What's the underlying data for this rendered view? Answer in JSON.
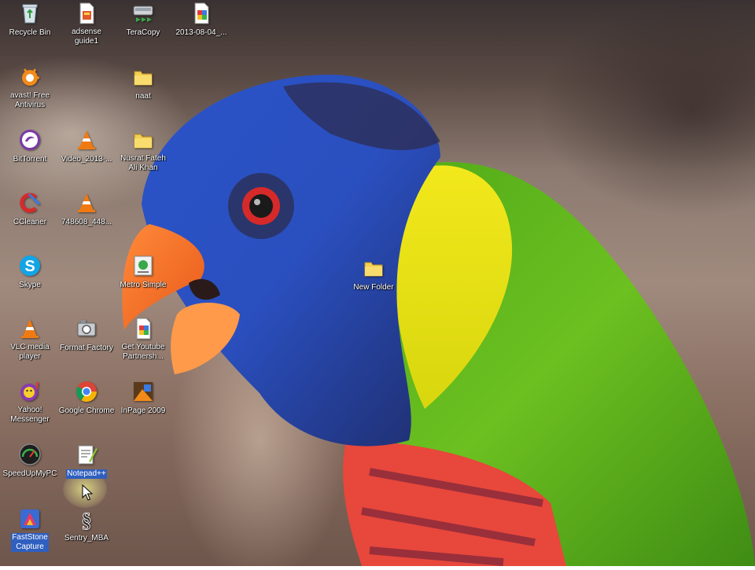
{
  "desktop": {
    "icons": [
      {
        "id": "recycle-bin",
        "label": "Recycle Bin",
        "icon": "recycle-bin-icon"
      },
      {
        "id": "adsense-guide1",
        "label": "adsense\nguide1",
        "icon": "document-icon"
      },
      {
        "id": "teracopy",
        "label": "TeraCopy",
        "icon": "teracopy-icon"
      },
      {
        "id": "screenshot-2013",
        "label": "2013-08-04_...",
        "icon": "image-file-icon"
      },
      {
        "id": "avast",
        "label": "avast! Free\nAntivirus",
        "icon": "avast-icon"
      },
      {
        "id": "naat",
        "label": "naat",
        "icon": "folder-icon"
      },
      {
        "id": "bittorrent",
        "label": "BitTorrent",
        "icon": "bittorrent-icon"
      },
      {
        "id": "video-2013",
        "label": "Video_2013-...",
        "icon": "vlc-cone-icon"
      },
      {
        "id": "nusrat",
        "label": "Nusrat Fateh\nAli Khan",
        "icon": "folder-icon"
      },
      {
        "id": "ccleaner",
        "label": "CCleaner",
        "icon": "ccleaner-icon"
      },
      {
        "id": "file-748608",
        "label": "748608_448...",
        "icon": "vlc-cone-icon"
      },
      {
        "id": "skype",
        "label": "Skype",
        "icon": "skype-icon"
      },
      {
        "id": "metro-simple",
        "label": "Metro Simple",
        "icon": "metro-simple-icon"
      },
      {
        "id": "new-folder",
        "label": "New Folder",
        "icon": "folder-icon"
      },
      {
        "id": "vlc",
        "label": "VLC media\nplayer",
        "icon": "vlc-cone-icon"
      },
      {
        "id": "format-factory",
        "label": "Format Factory",
        "icon": "format-factory-icon"
      },
      {
        "id": "get-youtube",
        "label": "Get Youtube\nPartnersh...",
        "icon": "image-file-icon"
      },
      {
        "id": "yahoo",
        "label": "Yahoo!\nMessenger",
        "icon": "yahoo-messenger-icon"
      },
      {
        "id": "chrome",
        "label": "Google Chrome",
        "icon": "chrome-icon"
      },
      {
        "id": "inpage",
        "label": "InPage 2009",
        "icon": "inpage-icon"
      },
      {
        "id": "speedup",
        "label": "SpeedUpMyPC",
        "icon": "speedometer-icon"
      },
      {
        "id": "notepadpp",
        "label": "Notepad++",
        "icon": "notepadpp-icon"
      },
      {
        "id": "faststone",
        "label": "FastStone\nCapture",
        "icon": "faststone-icon"
      },
      {
        "id": "sentry",
        "label": "Sentry_MBA",
        "icon": "sentry-icon"
      }
    ],
    "wallpaper": "rainbow-lorikeet-parrot",
    "colors": {
      "selection": "#2f5fbf",
      "label_text": "#ffffff"
    },
    "cursor": "arrow-pointer-icon"
  }
}
